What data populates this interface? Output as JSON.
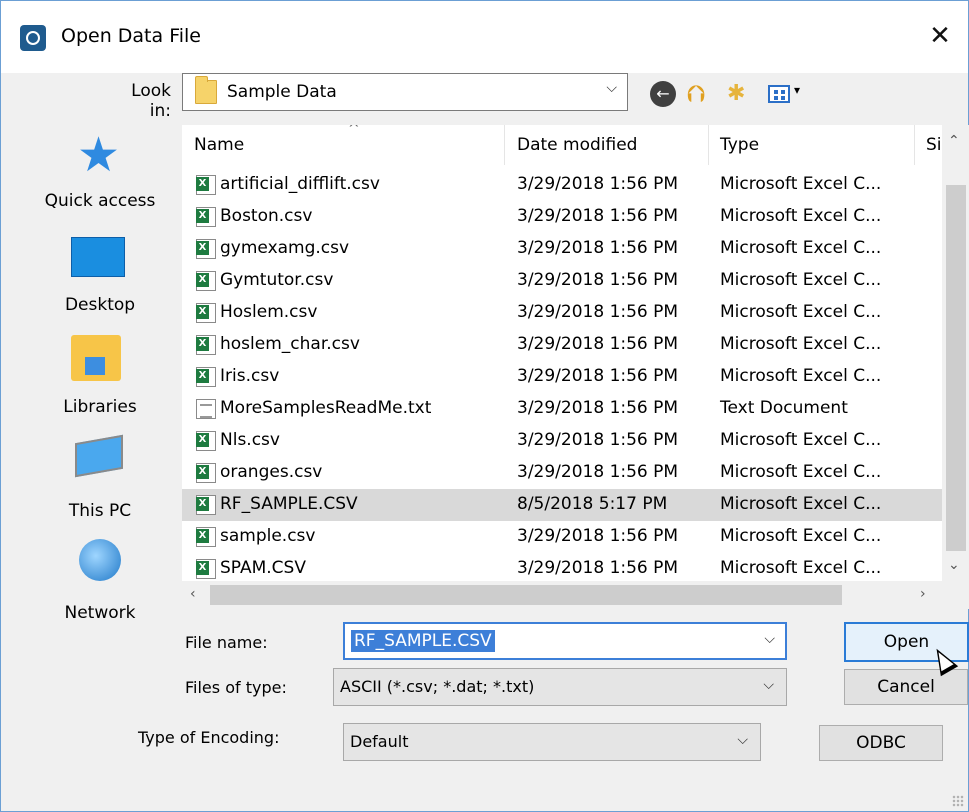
{
  "window": {
    "title": "Open Data File",
    "close_glyph": "✕"
  },
  "lookin": {
    "label": "Look in:",
    "value": "Sample Data",
    "arrow": "⌵"
  },
  "toolbar": {
    "back_glyph": "←",
    "up_glyph": "⮉",
    "newfolder_glyph": "✱",
    "view_caret": "▾"
  },
  "places": [
    {
      "label": "Quick access",
      "icon": "star-icon"
    },
    {
      "label": "Desktop",
      "icon": "desktop-icon"
    },
    {
      "label": "Libraries",
      "icon": "libraries-icon"
    },
    {
      "label": "This PC",
      "icon": "computer-icon"
    },
    {
      "label": "Network",
      "icon": "network-icon"
    }
  ],
  "columns": {
    "name": "Name",
    "date": "Date modified",
    "type": "Type",
    "size": "Si:"
  },
  "files": [
    {
      "name": "artificial_difflift.csv",
      "date": "3/29/2018 1:56 PM",
      "type": "Microsoft Excel C...",
      "icon": "excel"
    },
    {
      "name": "Boston.csv",
      "date": "3/29/2018 1:56 PM",
      "type": "Microsoft Excel C...",
      "icon": "excel"
    },
    {
      "name": "gymexamg.csv",
      "date": "3/29/2018 1:56 PM",
      "type": "Microsoft Excel C...",
      "icon": "excel"
    },
    {
      "name": "Gymtutor.csv",
      "date": "3/29/2018 1:56 PM",
      "type": "Microsoft Excel C...",
      "icon": "excel"
    },
    {
      "name": "Hoslem.csv",
      "date": "3/29/2018 1:56 PM",
      "type": "Microsoft Excel C...",
      "icon": "excel"
    },
    {
      "name": "hoslem_char.csv",
      "date": "3/29/2018 1:56 PM",
      "type": "Microsoft Excel C...",
      "icon": "excel"
    },
    {
      "name": "Iris.csv",
      "date": "3/29/2018 1:56 PM",
      "type": "Microsoft Excel C...",
      "icon": "excel"
    },
    {
      "name": "MoreSamplesReadMe.txt",
      "date": "3/29/2018 1:56 PM",
      "type": "Text Document",
      "icon": "text"
    },
    {
      "name": "Nls.csv",
      "date": "3/29/2018 1:56 PM",
      "type": "Microsoft Excel C...",
      "icon": "excel"
    },
    {
      "name": "oranges.csv",
      "date": "3/29/2018 1:56 PM",
      "type": "Microsoft Excel C...",
      "icon": "excel"
    },
    {
      "name": "RF_SAMPLE.CSV",
      "date": "8/5/2018 5:17 PM",
      "type": "Microsoft Excel C...",
      "icon": "excel",
      "selected": true
    },
    {
      "name": "sample.csv",
      "date": "3/29/2018 1:56 PM",
      "type": "Microsoft Excel C...",
      "icon": "excel"
    },
    {
      "name": "SPAM.CSV",
      "date": "3/29/2018 1:56 PM",
      "type": "Microsoft Excel C...",
      "icon": "excel"
    }
  ],
  "scroll": {
    "up": "⌃",
    "down": "⌄",
    "left": "‹",
    "right": "›"
  },
  "form": {
    "filename_label": "File name:",
    "filename_value": "RF_SAMPLE.CSV",
    "filetype_label": "Files of type:",
    "filetype_value": "ASCII (*.csv; *.dat; *.txt)",
    "encoding_label": "Type of Encoding:",
    "encoding_value": "Default",
    "arrow": "⌵"
  },
  "buttons": {
    "open": "Open",
    "cancel": "Cancel",
    "odbc": "ODBC"
  },
  "colors": {
    "selection": "#3d7fd8",
    "selected_row": "#d9d9d9",
    "accent": "#2a7bd6"
  }
}
